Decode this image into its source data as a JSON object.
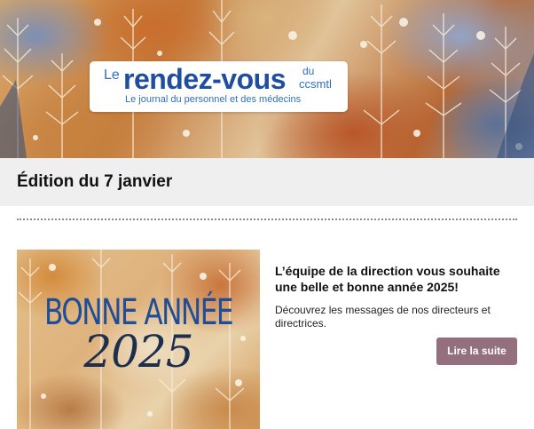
{
  "banner": {
    "logo": {
      "prefix": "Le",
      "name": "rendez-vous",
      "du": "du",
      "org": "ccsmtl",
      "tagline": "Le journal du personnel et des médecins"
    }
  },
  "edition": {
    "title": "Édition du 7 janvier"
  },
  "article": {
    "image_text_line1": "BONNE ANNÉE",
    "image_text_line2": "2025",
    "heading": "L’équipe de la direction vous souhaite une belle et bonne année 2025!",
    "description": "Découvrez les messages de nos directeurs et directrices.",
    "button_label": "Lire la suite"
  },
  "colors": {
    "logo_blue": "#1f4ea0",
    "button": "#94707f",
    "edition_bar": "#efefef"
  }
}
